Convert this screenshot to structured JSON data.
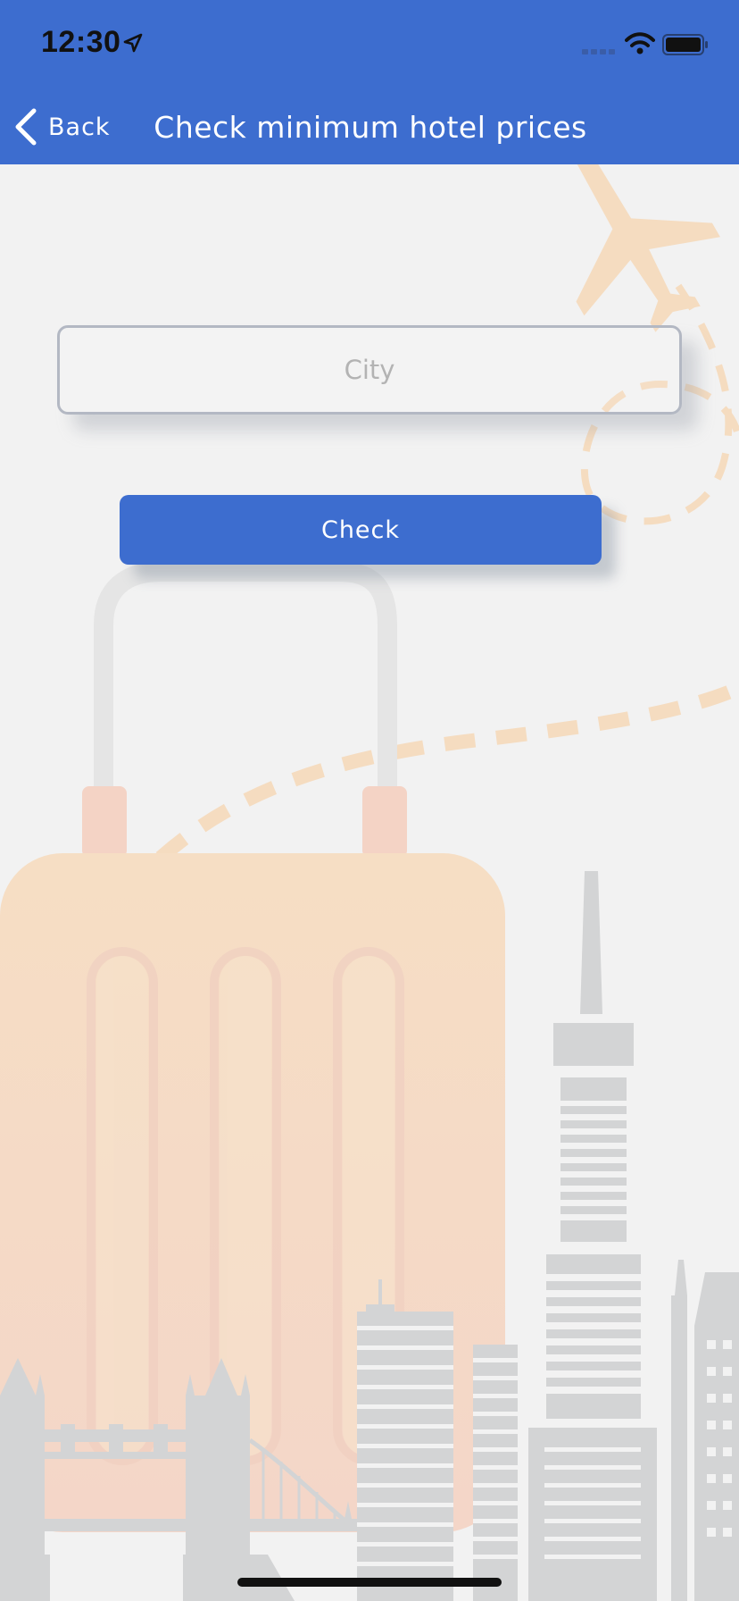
{
  "status_bar": {
    "time": "12:30"
  },
  "nav": {
    "back_label": "Back",
    "title": "Check minimum hotel prices"
  },
  "form": {
    "city_placeholder": "City",
    "city_value": "",
    "check_label": "Check"
  },
  "icons": {
    "status": [
      "location-arrow-icon",
      "cellular-signal-icon",
      "wifi-icon",
      "battery-icon"
    ],
    "nav": [
      "chevron-left-icon"
    ],
    "background": [
      "airplane-icon",
      "suitcase-illustration",
      "city-skyline-illustration"
    ]
  },
  "colors": {
    "accent": "#3d6dcf",
    "background": "#f2f2f2",
    "field_border": "#b3b8c3",
    "illustration_orange": "#f5d9b8",
    "illustration_gray": "#d3d4d5"
  }
}
